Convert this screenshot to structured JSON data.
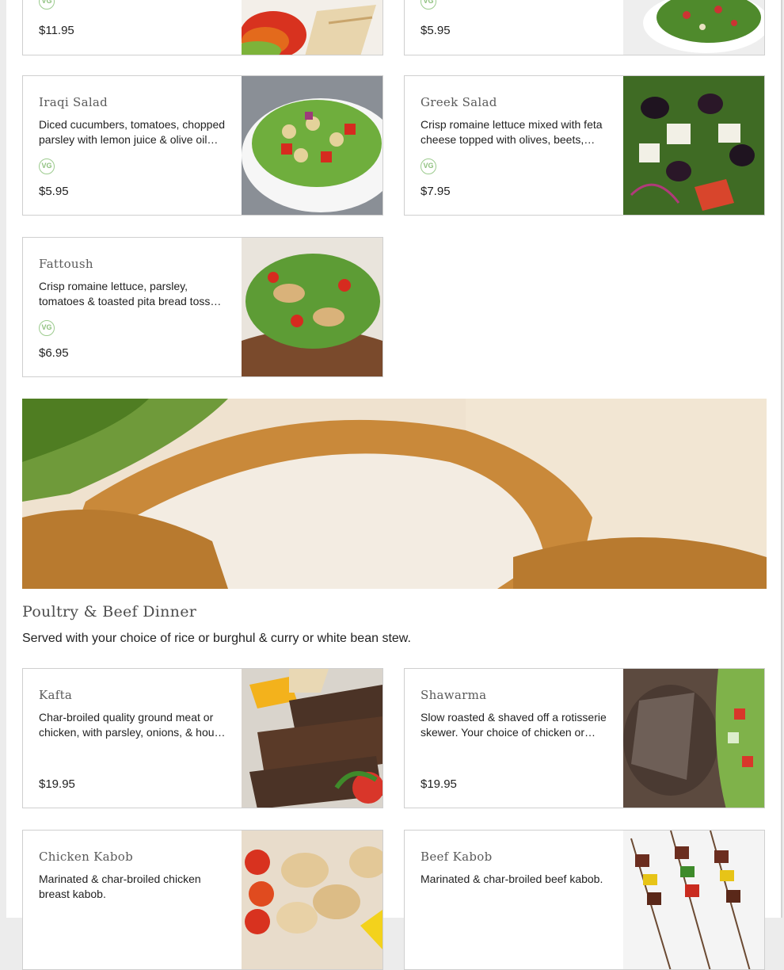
{
  "partial_cards": [
    {
      "price": "$11.95",
      "badge": "VG"
    },
    {
      "price": "$5.95",
      "badge": "VG"
    }
  ],
  "salads": [
    {
      "name": "Iraqi Salad",
      "description": "Diced cucumbers, tomatoes, chopped parsley with lemon juice & olive oil…",
      "badge": "VG",
      "price": "$5.95"
    },
    {
      "name": "Greek Salad",
      "description": "Crisp romaine lettuce mixed with feta cheese topped with olives, beets,…",
      "badge": "VG",
      "price": "$7.95"
    },
    {
      "name": "Fattoush",
      "description": "Crisp romaine lettuce, parsley, tomatoes & toasted pita bread toss…",
      "badge": "VG",
      "price": "$6.95"
    }
  ],
  "section": {
    "title": "Poultry & Beef Dinner",
    "subtitle": "Served with your choice of rice or burghul & curry or white bean stew."
  },
  "dinners": [
    {
      "name": "Kafta",
      "description": "Char-broiled quality ground meat or chicken, with parsley, onions, & hou…",
      "price": "$19.95"
    },
    {
      "name": "Shawarma",
      "description": "Slow roasted & shaved off a rotisserie skewer. Your choice of chicken or beef.",
      "price": "$19.95"
    },
    {
      "name": "Chicken Kabob",
      "description": "Marinated & char-broiled chicken breast kabob."
    },
    {
      "name": "Beef Kabob",
      "description": "Marinated & char-broiled beef kabob."
    }
  ],
  "colors": {
    "vegan_badge": "#8ec07e",
    "card_border": "#cfcfcf",
    "title_text": "#5a5a5a"
  }
}
